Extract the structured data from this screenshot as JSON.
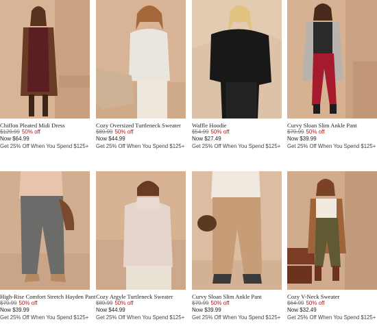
{
  "products": [
    {
      "name": "Chiffon Pleated Midi Dress",
      "was_price": "$129.99",
      "discount": "50% off",
      "now_price": "Now $64.99",
      "promo": "Get 25% Off When You Spend $125+"
    },
    {
      "name": "Cozy Oversized Turtleneck Sweater",
      "was_price": "$89.99",
      "discount": "50% off",
      "now_price": "Now $44.99",
      "promo": "Get 25% Off When You Spend $125+"
    },
    {
      "name": "Waffle Hoodie",
      "was_price": "$54.99",
      "discount": "50% off",
      "now_price": "Now $27.49",
      "promo": "Get 25% Off When You Spend $125+"
    },
    {
      "name": "Curvy Sloan Slim Ankle Pant",
      "was_price": "$79.99",
      "discount": "50% off",
      "now_price": "Now $39.99",
      "promo": "Get 25% Off When You Spend $125+"
    },
    {
      "name": "High-Rise Comfort Stretch Hayden Pant",
      "was_price": "$79.99",
      "discount": "50% off",
      "now_price": "Now $39.99",
      "promo": "Get 25% Off When You Spend $125+"
    },
    {
      "name": "Cozy Argyle Turtleneck Sweater",
      "was_price": "$89.99",
      "discount": "50% off",
      "now_price": "Now $44.99",
      "promo": "Get 25% Off When You Spend $125+"
    },
    {
      "name": "Curvy Sloan Slim Ankle Pant",
      "was_price": "$79.99",
      "discount": "50% off",
      "now_price": "Now $39.99",
      "promo": "Get 25% Off When You Spend $125+"
    },
    {
      "name": "Cozy V-Neck Sweater",
      "was_price": "$64.99",
      "discount": "50% off",
      "now_price": "Now $32.49",
      "promo": "Get 25% Off When You Spend $125+"
    }
  ],
  "colors": {
    "sale_red": "#b3150e",
    "backdrop_beige": "#d8b79c"
  }
}
